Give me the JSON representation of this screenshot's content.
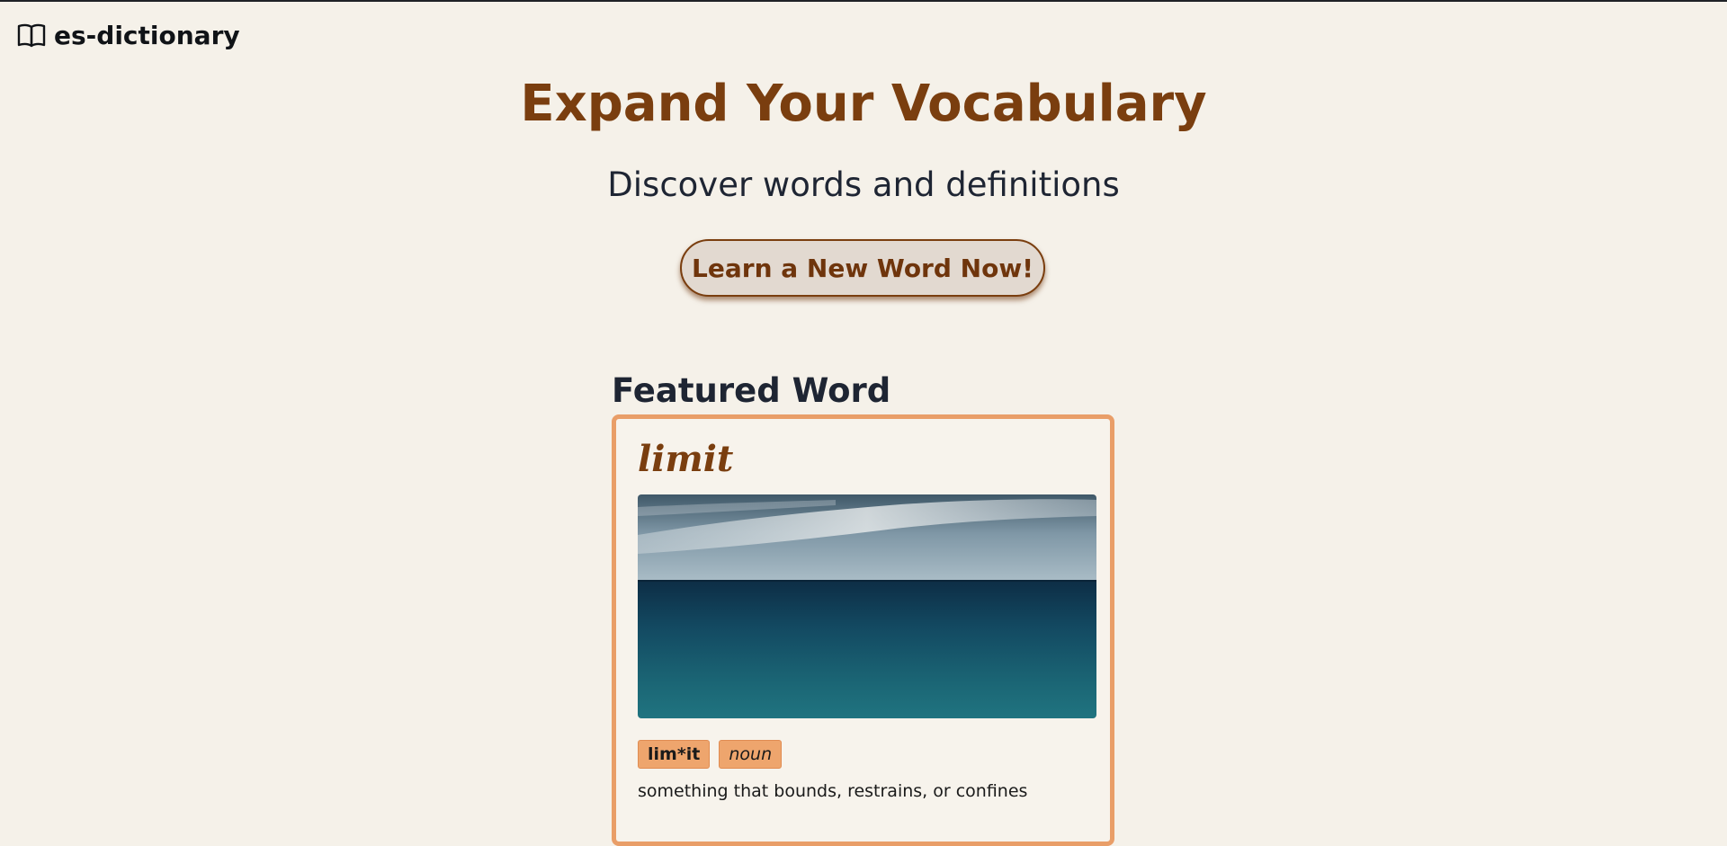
{
  "header": {
    "brand_name": "es-dictionary",
    "brand_icon": "open-book-icon"
  },
  "hero": {
    "title": "Expand Your Vocabulary",
    "subtitle": "Discover words and definitions",
    "cta_label": "Learn a New Word Now!"
  },
  "featured": {
    "heading": "Featured Word",
    "word": "limit",
    "image_subject": "ocean horizon",
    "syllables": "lim*it",
    "part_of_speech": "noun",
    "definition": "something that bounds, restrains, or confines"
  },
  "colors": {
    "background": "#f5f1e9",
    "accent_brown": "#7a3e0f",
    "text_dark": "#1e2533",
    "card_border": "#e99e68",
    "tag_fill": "#eea56d"
  }
}
